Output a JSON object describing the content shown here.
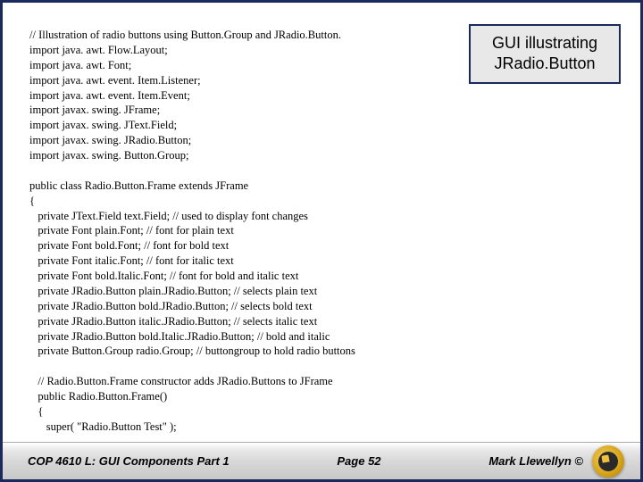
{
  "callout": {
    "line1": "GUI illustrating",
    "line2": "JRadio.Button"
  },
  "code": {
    "text": "// Illustration of radio buttons using Button.Group and JRadio.Button.\nimport java. awt. Flow.Layout;\nimport java. awt. Font;\nimport java. awt. event. Item.Listener;\nimport java. awt. event. Item.Event;\nimport javax. swing. JFrame;\nimport javax. swing. JText.Field;\nimport javax. swing. JRadio.Button;\nimport javax. swing. Button.Group;\n\npublic class Radio.Button.Frame extends JFrame\n{\n   private JText.Field text.Field; // used to display font changes\n   private Font plain.Font; // font for plain text\n   private Font bold.Font; // font for bold text\n   private Font italic.Font; // font for italic text\n   private Font bold.Italic.Font; // font for bold and italic text\n   private JRadio.Button plain.JRadio.Button; // selects plain text\n   private JRadio.Button bold.JRadio.Button; // selects bold text\n   private JRadio.Button italic.JRadio.Button; // selects italic text\n   private JRadio.Button bold.Italic.JRadio.Button; // bold and italic\n   private Button.Group radio.Group; // buttongroup to hold radio buttons\n\n   // Radio.Button.Frame constructor adds JRadio.Buttons to JFrame\n   public Radio.Button.Frame()\n   {\n      super( \"Radio.Button Test\" );"
  },
  "footer": {
    "left": "COP 4610 L: GUI Components Part 1",
    "center": "Page 52",
    "right": "Mark Llewellyn ©"
  }
}
